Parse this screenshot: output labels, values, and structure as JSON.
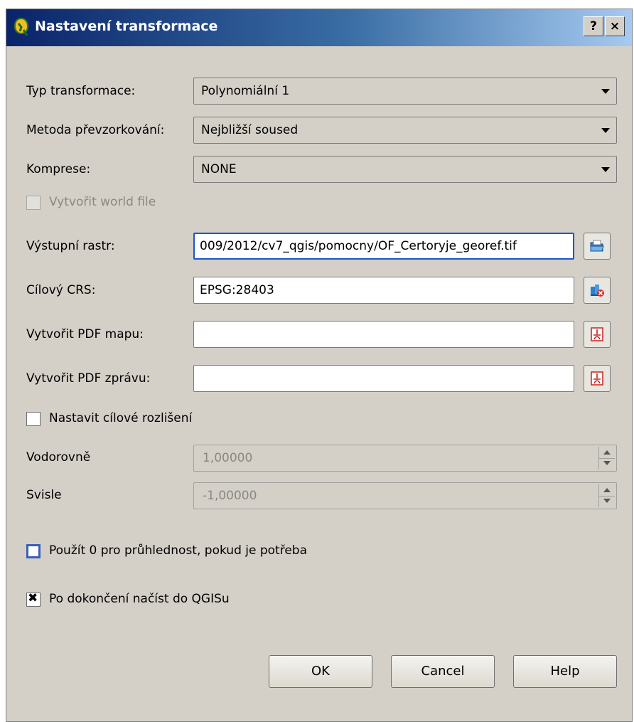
{
  "window": {
    "title": "Nastavení transformace",
    "help_button": "?",
    "close_button": "×",
    "title_gradient": [
      "#0a246a",
      "#a6caf0"
    ]
  },
  "form": {
    "transform_type": {
      "label": "Typ transformace:",
      "value": "Polynomiální 1"
    },
    "resampling": {
      "label": "Metoda převzorkování:",
      "value": "Nejbližší soused"
    },
    "compression": {
      "label": "Komprese:",
      "value": "NONE"
    },
    "world_file": {
      "label": "Vytvořit world file",
      "checked": false,
      "enabled": false
    },
    "output_raster": {
      "label": "Výstupní rastr:",
      "value": "009/2012/cv7_qgis/pomocny/OF_Certoryje_georef.tif",
      "icon": "folder-open-icon"
    },
    "target_crs": {
      "label": "Cílový CRS:",
      "value": "EPSG:28403",
      "icon": "crs-select-icon"
    },
    "pdf_map": {
      "label": "Vytvořit PDF mapu:",
      "value": "",
      "icon": "pdf-icon"
    },
    "pdf_report": {
      "label": "Vytvořit PDF zprávu:",
      "value": "",
      "icon": "pdf-icon"
    },
    "set_resolution": {
      "label": "Nastavit cílové rozlišení",
      "checked": false
    },
    "horizontal": {
      "label": "Vodorovně",
      "value": "1,00000",
      "enabled": false
    },
    "vertical": {
      "label": "Svisle",
      "value": "-1,00000",
      "enabled": false
    },
    "use_zero_transparency": {
      "label": "Použít 0 pro průhlednost, pokud je potřeba",
      "checked": false
    },
    "load_in_qgis": {
      "label": "Po dokončení načíst do QGISu",
      "checked": true
    }
  },
  "buttons": {
    "ok": "OK",
    "cancel": "Cancel",
    "help": "Help"
  },
  "colors": {
    "dialog_bg": "#d4d0c8",
    "focus": "#1a58c8",
    "pdf_red": "#c8201c"
  }
}
